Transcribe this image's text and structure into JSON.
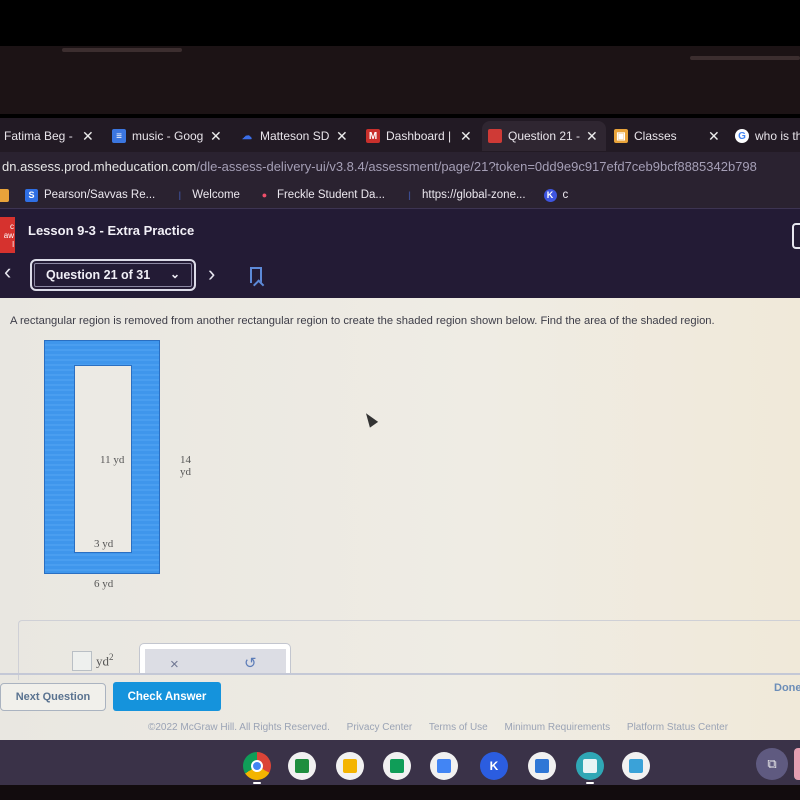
{
  "browser": {
    "tabs": [
      {
        "label": "Fatima Beg -",
        "icon": "generic-favicon",
        "close": "✕"
      },
      {
        "label": "music - Goog",
        "icon": "google-docs-icon",
        "close": "✕"
      },
      {
        "label": "Matteson SD",
        "icon": "cloud-icon",
        "close": "✕"
      },
      {
        "label": "Dashboard |",
        "icon": "m-logo-icon",
        "icon_text": "M",
        "close": "✕"
      },
      {
        "label": "Question 21 -",
        "icon": "mcgraw-hill-icon",
        "close": "✕",
        "active": true
      },
      {
        "label": "Classes",
        "icon": "google-classroom-icon",
        "close": "✕"
      },
      {
        "label": "who is the",
        "icon": "google-icon",
        "icon_text": "G"
      }
    ],
    "url": {
      "host": "dn.assess.prod.mheducation.com",
      "path": "/dle-assess-delivery-ui/v3.8.4/assessment/page/21?token=0dd9e9c917efd7ceb9bcf8885342b798"
    },
    "bookmarks": [
      {
        "label": "",
        "icon": "classroom-icon"
      },
      {
        "label": "Pearson/Savvas Re...",
        "icon": "savvas-icon",
        "icon_text": "S"
      },
      {
        "label": "Welcome",
        "icon": "k-logo-icon"
      },
      {
        "label": "Freckle Student Da...",
        "icon": "freckle-icon"
      },
      {
        "label": "https://global-zone...",
        "icon": "k-logo-icon"
      },
      {
        "label": "c",
        "icon": "kahoot-icon",
        "icon_text": "K"
      }
    ]
  },
  "app": {
    "logo_text": "c\naw\nl",
    "lesson_title": "Lesson 9-3 - Extra Practice",
    "question_selector": "Question 21 of 31",
    "prev_icon": "‹",
    "next_icon": "›"
  },
  "question": {
    "text": "A rectangular region is removed from another rectangular region to create the shaded region shown below. Find the area of the shaded region.",
    "figure": {
      "shaded_color": "#3f96ec",
      "labels": {
        "inner_height": "11 yd",
        "outer_height": "14 yd",
        "inner_width": "3 yd",
        "outer_width": "6 yd"
      }
    },
    "answer": {
      "value": "",
      "unit": "yd",
      "unit_exponent": "2"
    },
    "tools": {
      "clear": "×",
      "undo": "↺"
    }
  },
  "actions": {
    "next_question": "Next Question",
    "check_answer": "Check Answer",
    "done": "Done",
    "check_color": "#1593dc"
  },
  "footer": {
    "copyright": "©2022 McGraw Hill. All Rights Reserved.",
    "links": [
      "Privacy Center",
      "Terms of Use",
      "Minimum Requirements",
      "Platform Status Center"
    ]
  },
  "shelf": {
    "apps": [
      "chrome",
      "google-classroom",
      "google-slides",
      "google-sheets",
      "google-docs",
      "kami",
      "screencastify",
      "app-launcher",
      "cloud-app"
    ]
  }
}
